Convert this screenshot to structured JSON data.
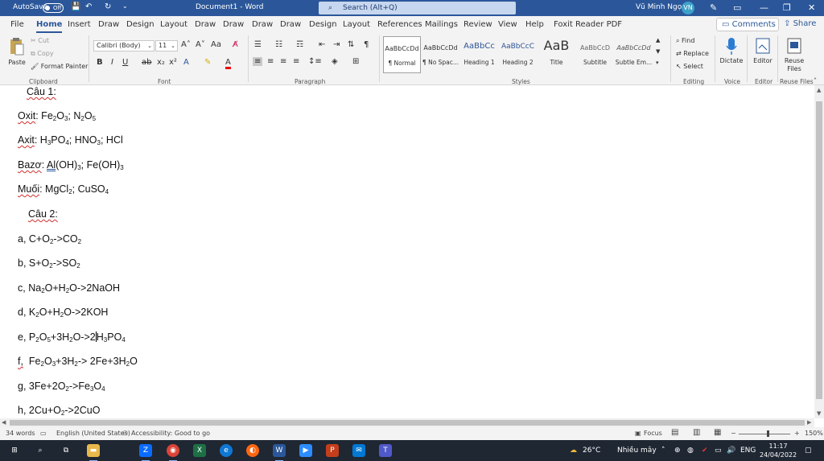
{
  "titlebar": {
    "autosave_label": "AutoSave",
    "autosave_state": "Off",
    "doc_title": "Document1 - Word",
    "search_placeholder": "Search (Alt+Q)",
    "user_name": "Vũ Minh Ngọc",
    "avatar_initials": "VN"
  },
  "menu": {
    "items": [
      "File",
      "Home",
      "Insert",
      "Draw",
      "Design",
      "Layout",
      "Draw",
      "Draw",
      "Draw",
      "Draw",
      "Design",
      "Layout",
      "References",
      "Mailings",
      "Review",
      "View",
      "Help",
      "Foxit Reader PDF"
    ],
    "active": "Home",
    "comments_label": "Comments",
    "share_label": "Share"
  },
  "ribbon": {
    "clipboard": {
      "paste": "Paste",
      "cut": "Cut",
      "copy": "Copy",
      "format_painter": "Format Painter",
      "label": "Clipboard"
    },
    "font": {
      "family": "Calibri (Body)",
      "size": "11",
      "label": "Font"
    },
    "paragraph": {
      "label": "Paragraph"
    },
    "styles": {
      "label": "Styles",
      "items": [
        {
          "preview": "AaBbCcDd",
          "name": "¶ Normal"
        },
        {
          "preview": "AaBbCcDd",
          "name": "¶ No Spac..."
        },
        {
          "preview": "AaBbCc",
          "name": "Heading 1"
        },
        {
          "preview": "AaBbCcC",
          "name": "Heading 2"
        },
        {
          "preview": "AaB",
          "name": "Title"
        },
        {
          "preview": "AaBbCcD",
          "name": "Subtitle"
        },
        {
          "preview": "AaBbCcDd",
          "name": "Subtle Em..."
        }
      ]
    },
    "editing": {
      "find": "Find",
      "replace": "Replace",
      "select": "Select",
      "label": "Editing"
    },
    "voice": {
      "dictate": "Dictate",
      "label": "Voice"
    },
    "editor": {
      "editor": "Editor",
      "label": "Editor"
    },
    "reuse": {
      "reuse_files": "Reuse Files",
      "label": "Reuse Files"
    }
  },
  "document": {
    "cau1": "Câu 1:",
    "oxit_label": "Oxit",
    "axit_label": "Axit",
    "bazo_label": "Bazơ",
    "muoi_label": "Muối",
    "cau2": "Câu 2:"
  },
  "status": {
    "words": "34 words",
    "language": "English (United States)",
    "accessibility": "Accessibility: Good to go",
    "focus": "Focus",
    "zoom": "150%"
  },
  "taskbar": {
    "weather_temp": "26°C",
    "weather_text": "Nhiều mây",
    "lang": "ENG",
    "time": "11:17",
    "date": "24/04/2022"
  }
}
